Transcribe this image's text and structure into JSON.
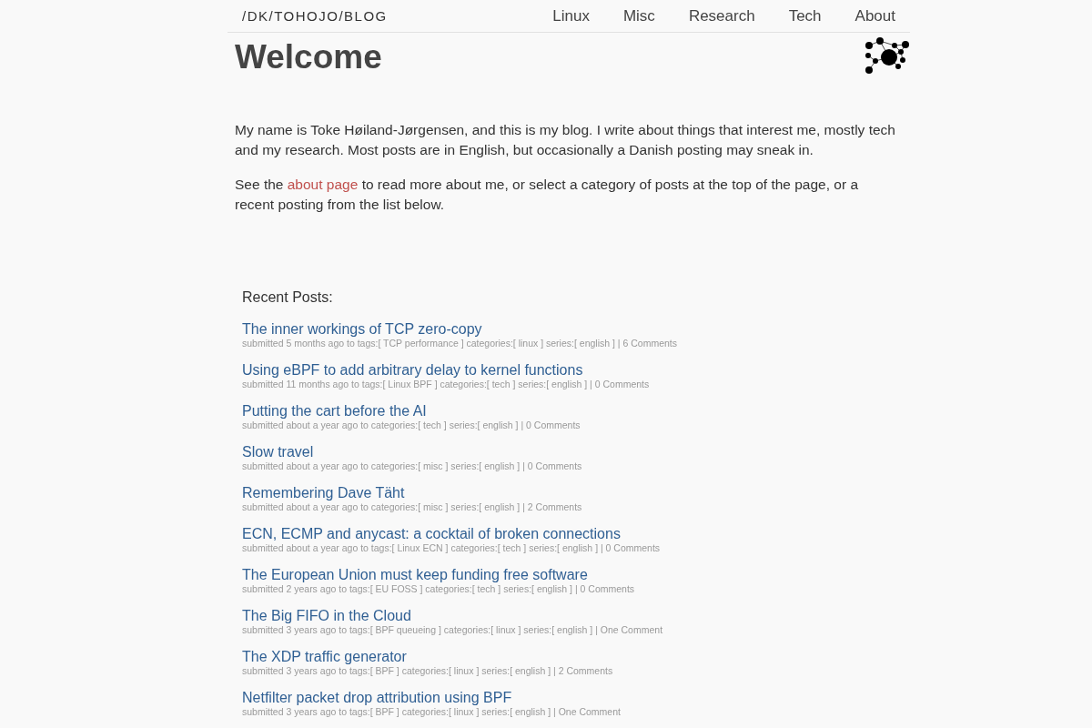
{
  "header": {
    "brand": "/DK/TOHOJO/BLOG",
    "nav": [
      "Linux",
      "Misc",
      "Research",
      "Tech",
      "About"
    ]
  },
  "page": {
    "title": "Welcome",
    "paragraphs": [
      {
        "parts": [
          {
            "kind": "text",
            "text": "My name is Toke Høiland-Jørgensen, and this is my blog. I write about things that interest me, mostly tech and my research. Most posts are in English, but occasionally a Danish posting may sneak in."
          }
        ]
      },
      {
        "parts": [
          {
            "kind": "text",
            "text": "See the "
          },
          {
            "kind": "link",
            "text": "about page"
          },
          {
            "kind": "text",
            "text": " to read more about me, or select a category of posts at the top of the page, or a recent posting from the list below."
          }
        ]
      }
    ]
  },
  "recent_posts": {
    "heading": "Recent Posts:",
    "posts": [
      {
        "title": "The inner workings of TCP zero-copy",
        "meta": "submitted 5 months ago to tags:[ TCP performance ] categories:[ linux ] series:[ english ] | 6 Comments"
      },
      {
        "title": "Using eBPF to add arbitrary delay to kernel functions",
        "meta": "submitted 11 months ago to tags:[ Linux BPF ] categories:[ tech ] series:[ english ] | 0 Comments"
      },
      {
        "title": "Putting the cart before the AI",
        "meta": "submitted about a year ago to categories:[ tech ] series:[ english ] | 0 Comments"
      },
      {
        "title": "Slow travel",
        "meta": "submitted about a year ago to categories:[ misc ] series:[ english ] | 0 Comments"
      },
      {
        "title": "Remembering Dave Täht",
        "meta": "submitted about a year ago to categories:[ misc ] series:[ english ] | 2 Comments"
      },
      {
        "title": "ECN, ECMP and anycast: a cocktail of broken connections",
        "meta": "submitted about a year ago to tags:[ Linux ECN ] categories:[ tech ] series:[ english ] | 0 Comments"
      },
      {
        "title": "The European Union must keep funding free software",
        "meta": "submitted 2 years ago to tags:[ EU FOSS ] categories:[ tech ] series:[ english ] | 0 Comments"
      },
      {
        "title": "The Big FIFO in the Cloud",
        "meta": "submitted 3 years ago to tags:[ BPF queueing ] categories:[ linux ] series:[ english ] | One Comment"
      },
      {
        "title": "The XDP traffic generator",
        "meta": "submitted 3 years ago to tags:[ BPF ] categories:[ linux ] series:[ english ] | 2 Comments"
      },
      {
        "title": "Netfilter packet drop attribution using BPF",
        "meta": "submitted 3 years ago to tags:[ BPF ] categories:[ linux ] series:[ english ] | One Comment"
      }
    ]
  }
}
